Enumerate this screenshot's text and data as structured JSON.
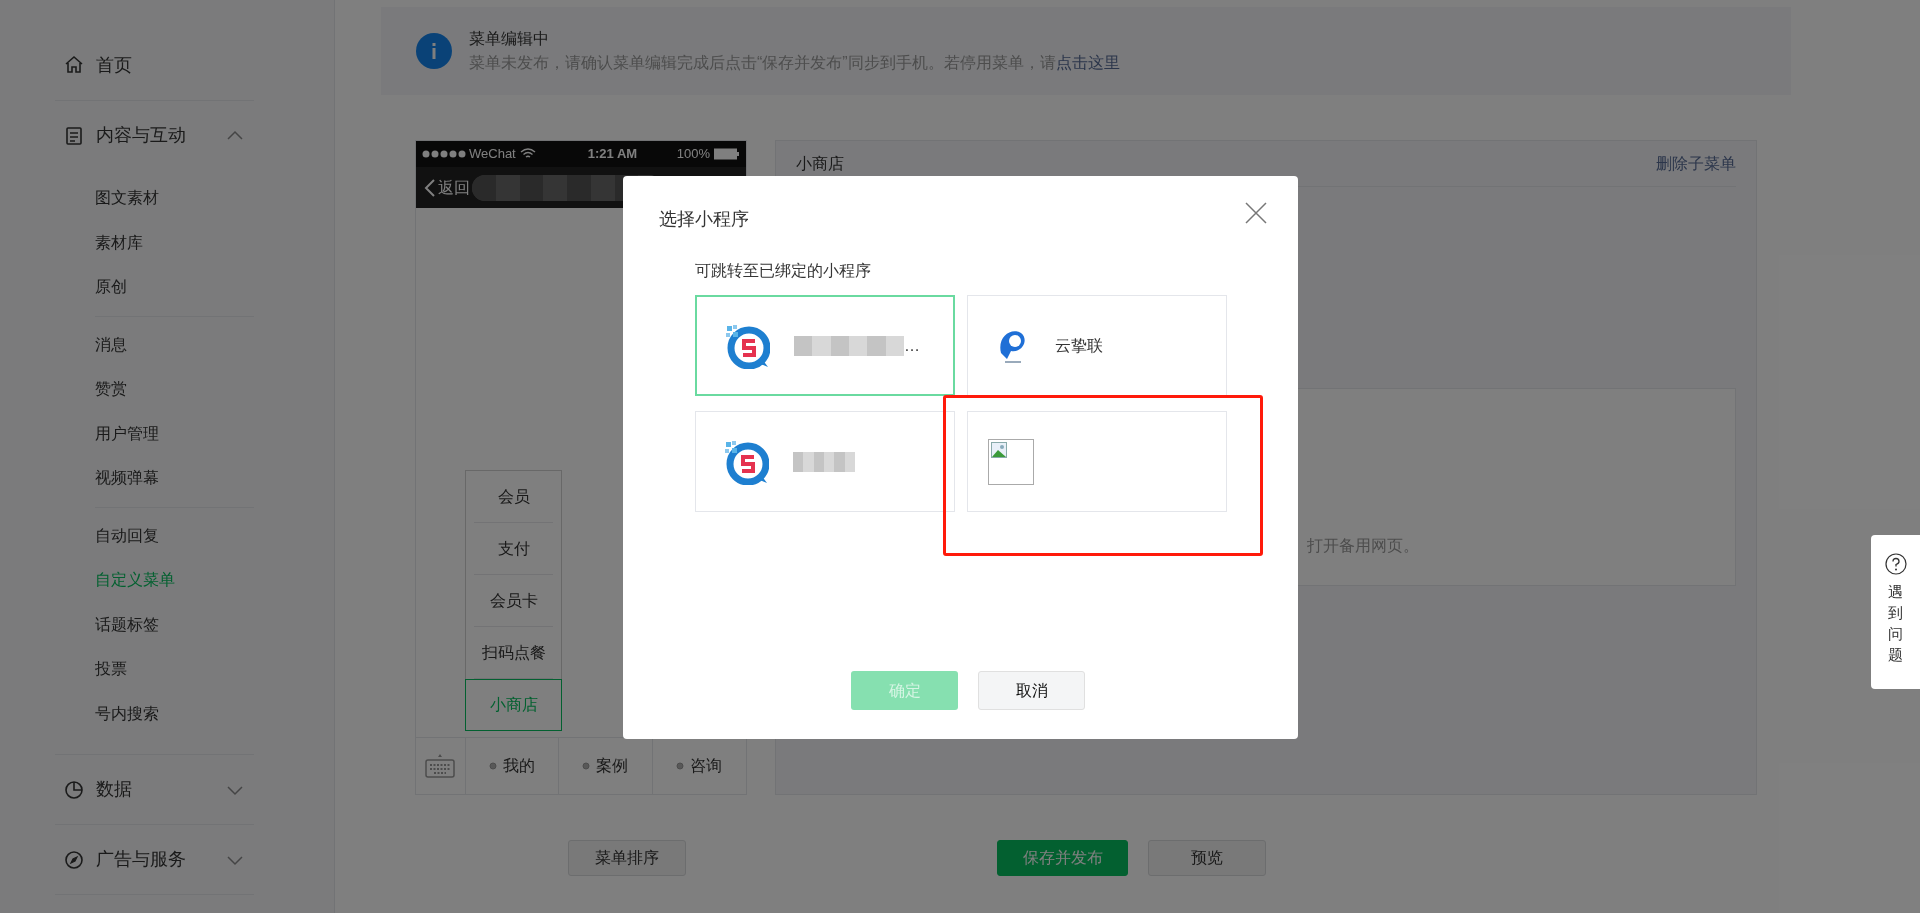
{
  "sidebar": {
    "sections": [
      {
        "label": "首页"
      },
      {
        "label": "内容与互动",
        "expanded": true,
        "groups": [
          [
            {
              "label": "图文素材",
              "selected": false
            },
            {
              "label": "素材库",
              "selected": false
            },
            {
              "label": "原创",
              "selected": false
            }
          ],
          [
            {
              "label": "消息",
              "selected": false
            },
            {
              "label": "赞赏",
              "selected": false
            },
            {
              "label": "用户管理",
              "selected": false
            },
            {
              "label": "视频弹幕",
              "selected": false
            }
          ],
          [
            {
              "label": "自动回复",
              "selected": false
            },
            {
              "label": "自定义菜单",
              "selected": true
            },
            {
              "label": "话题标签",
              "selected": false
            },
            {
              "label": "投票",
              "selected": false
            },
            {
              "label": "号内搜索",
              "selected": false
            }
          ]
        ]
      },
      {
        "label": "数据",
        "expanded": false
      },
      {
        "label": "广告与服务",
        "expanded": false
      }
    ]
  },
  "banner": {
    "title": "菜单编辑中",
    "text": "菜单未发布，请确认菜单编辑完成后点击“保存并发布”同步到手机。若停用菜单，请",
    "link": "点击这里"
  },
  "phone": {
    "status_bar": {
      "carrier": "WeChat",
      "time": "1:21 AM",
      "battery": "100%"
    },
    "back": "返回",
    "submenu": [
      {
        "label": "会员",
        "selected": false
      },
      {
        "label": "支付",
        "selected": false
      },
      {
        "label": "会员卡",
        "selected": false
      },
      {
        "label": "扫码点餐",
        "selected": false
      },
      {
        "label": "小商店",
        "selected": true
      }
    ],
    "menu_bar": [
      "我的",
      "案例",
      "咨询"
    ]
  },
  "panel": {
    "title": "小商店",
    "delete_link": "删除子菜单",
    "note": "打开备用网页。"
  },
  "footer_buttons": [
    {
      "label": "菜单排序",
      "kind": "default"
    },
    {
      "label": "保存并发布",
      "kind": "primary"
    },
    {
      "label": "预览",
      "kind": "default"
    }
  ],
  "modal": {
    "title": "选择小程序",
    "subtitle": "可跳转至已绑定的小程序",
    "options": [
      {
        "kind": "s-app",
        "name": "…",
        "redacted": true,
        "selected": true
      },
      {
        "kind": "p-app",
        "name": "云挚联",
        "redacted": false,
        "selected": false
      },
      {
        "kind": "s-app",
        "redacted": true,
        "selected": false
      },
      {
        "kind": "missing-image",
        "redacted": false,
        "selected": false
      }
    ],
    "confirm": {
      "label": "确定",
      "disabled": true
    },
    "cancel": {
      "label": "取消"
    }
  },
  "help": {
    "label": "遇到问题"
  }
}
